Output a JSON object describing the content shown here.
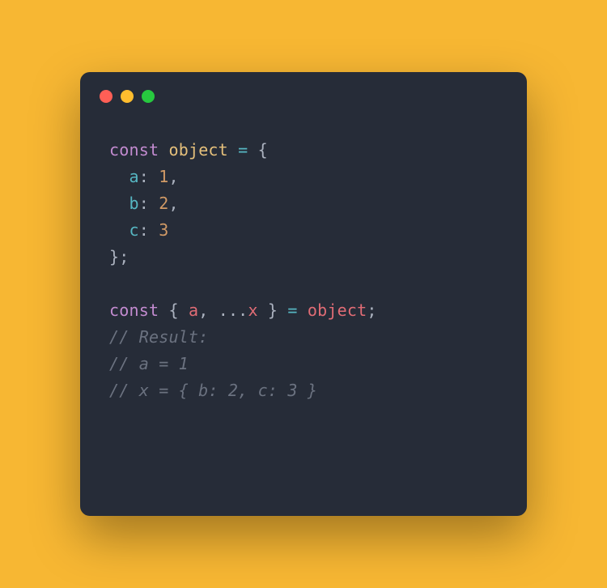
{
  "titlebar": {
    "red": "close",
    "yellow": "minimize",
    "green": "zoom"
  },
  "code": {
    "l1": {
      "kw": "const",
      "sp1": " ",
      "ident": "object",
      "sp2": " ",
      "op": "=",
      "sp3": " ",
      "brace": "{"
    },
    "l2": {
      "indent": "  ",
      "prop": "a",
      "colon": ":",
      "sp": " ",
      "num": "1",
      "comma": ","
    },
    "l3": {
      "indent": "  ",
      "prop": "b",
      "colon": ":",
      "sp": " ",
      "num": "2",
      "comma": ","
    },
    "l4": {
      "indent": "  ",
      "prop": "c",
      "colon": ":",
      "sp": " ",
      "num": "3"
    },
    "l5": {
      "close": "};"
    },
    "l6": "",
    "l7": {
      "kw": "const",
      "sp1": " ",
      "open": "{ ",
      "a": "a",
      "comma": ",",
      "sp2": " ",
      "spread": "...",
      "x": "x",
      "close": " }",
      "sp3": " ",
      "op": "=",
      "sp4": " ",
      "obj": "object",
      "semi": ";"
    },
    "l8": "// Result:",
    "l9": "// a = 1",
    "l10": "// x = { b: 2, c: 3 }"
  }
}
